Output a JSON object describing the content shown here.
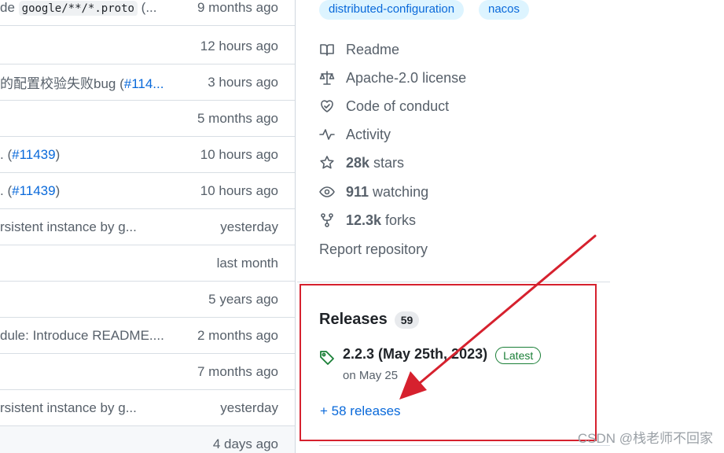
{
  "file_list": {
    "rows": [
      {
        "msg_prefix": "de ",
        "msg_code": "google/**/*.proto",
        "msg_suffix": " (...",
        "time": "9 months ago"
      },
      {
        "msg_prefix": "",
        "msg_code": "",
        "msg_suffix": "",
        "time": "12 hours ago"
      },
      {
        "msg_prefix": "的配置校验失败bug (",
        "msg_link": "#114...",
        "msg_suffix": "",
        "time": "3 hours ago"
      },
      {
        "msg_prefix": "",
        "msg_code": "",
        "msg_suffix": "",
        "time": "5 months ago"
      },
      {
        "msg_prefix": ". (",
        "msg_link": "#11439",
        "msg_suffix": ")",
        "time": "10 hours ago"
      },
      {
        "msg_prefix": ". (",
        "msg_link": "#11439",
        "msg_suffix": ")",
        "time": "10 hours ago"
      },
      {
        "msg_prefix": "rsistent instance by g...",
        "msg_code": "",
        "msg_suffix": "",
        "time": "yesterday"
      },
      {
        "msg_prefix": "",
        "msg_code": "",
        "msg_suffix": "",
        "time": "last month"
      },
      {
        "msg_prefix": "",
        "msg_code": "",
        "msg_suffix": "",
        "time": "5 years ago"
      },
      {
        "msg_prefix": "dule: Introduce README....",
        "msg_code": "",
        "msg_suffix": "",
        "time": "2 months ago"
      },
      {
        "msg_prefix": "",
        "msg_code": "",
        "msg_suffix": "",
        "time": "7 months ago"
      },
      {
        "msg_prefix": "rsistent instance by g...",
        "msg_code": "",
        "msg_suffix": "",
        "time": "yesterday"
      },
      {
        "msg_prefix": "",
        "msg_code": "",
        "msg_suffix": "",
        "time": "4 days ago"
      }
    ]
  },
  "sidebar": {
    "topics": [
      "distributed-configuration",
      "nacos"
    ],
    "readme": "Readme",
    "license": "Apache-2.0 license",
    "conduct": "Code of conduct",
    "activity": "Activity",
    "stars_count": "28k",
    "stars_label": "stars",
    "watching_count": "911",
    "watching_label": "watching",
    "forks_count": "12.3k",
    "forks_label": "forks",
    "report": "Report repository"
  },
  "releases": {
    "title": "Releases",
    "count": "59",
    "latest_name": "2.2.3 (May 25th, 2023)",
    "latest_badge": "Latest",
    "latest_date": "on May 25",
    "more_link": "+ 58 releases"
  },
  "annotation": {
    "box_color": "#d6212e",
    "arrow_color": "#d6212e"
  },
  "watermark": "CSDN @栈老师不回家",
  "colors": {
    "link": "#0969da",
    "muted": "#57606a",
    "latest_green": "#1a7f37",
    "topic_bg": "#ddf4ff"
  }
}
